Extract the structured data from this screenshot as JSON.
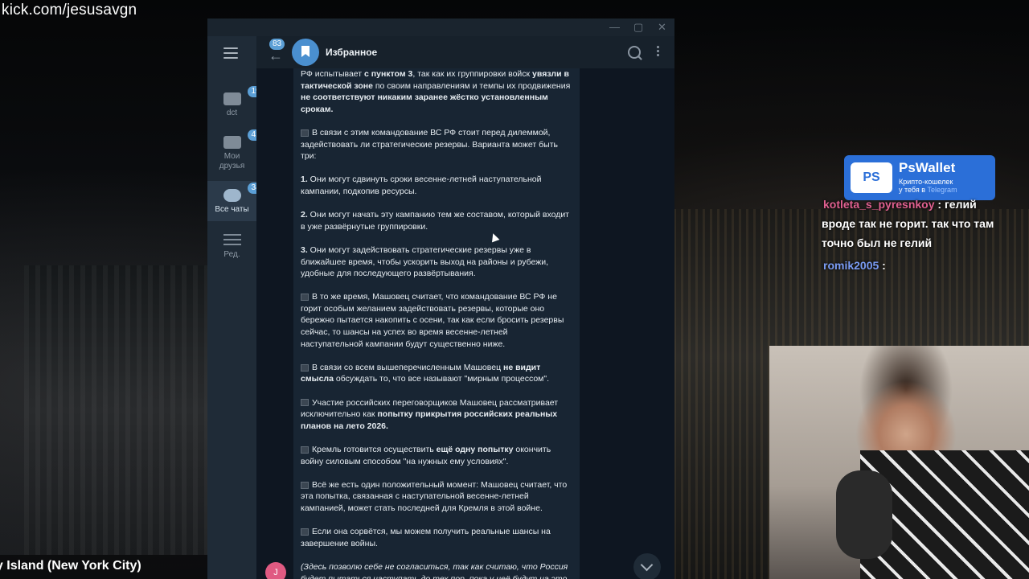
{
  "overlay": {
    "url": "kick.com/jesusavgn",
    "location": "ey Island (New York City)"
  },
  "window": {
    "controls": [
      "—",
      "▢",
      "✕"
    ]
  },
  "rail": {
    "folders": [
      {
        "label": "dct",
        "badge": "191"
      },
      {
        "label": "Мои друзья",
        "badge": "41"
      },
      {
        "label": "Все чаты",
        "badge": "349"
      },
      {
        "label": "Ред.",
        "badge": ""
      }
    ]
  },
  "header": {
    "back_badge": "83",
    "title": "Избранное"
  },
  "message": {
    "p1_a": "РФ испытывает ",
    "p1_b": "с пунктом 3",
    "p1_c": ", так как их группировки войск ",
    "p1_d": "увязли в тактической зоне",
    "p1_e": " по своим направлениям и темпы их продвижения ",
    "p1_f": "не соответствуют никаким заранее жёстко установленным срокам.",
    "p2": "В связи с этим командование ВС РФ стоит перед дилеммой, задействовать ли стратегические резервы. Варианта может быть три:",
    "p3_n": "1.",
    "p3": " Они могут сдвинуть сроки весенне-летней наступательной кампании, подкопив ресурсы.",
    "p4_n": "2.",
    "p4": " Они могут начать эту кампанию тем же составом, который входит в уже развёрнутые группировки.",
    "p5_n": "3.",
    "p5": " Они могут задействовать стратегические резервы уже в ближайшее время, чтобы ускорить выход на районы и рубежи, удобные для последующего развёртывания.",
    "p6": "В то же время, Машовец считает, что командование ВС РФ не горит особым желанием задействовать резервы, которые оно бережно пытается накопить с осени, так как если бросить резервы сейчас, то шансы на успех во время весенне-летней наступательной кампании будут существенно ниже.",
    "p7_a": "В связи со всем вышеперечисленным Машовец ",
    "p7_b": "не видит смысла",
    "p7_c": " обсуждать то, что все называют \"мирным процессом\".",
    "p8_a": "Участие российских переговорщиков Машовец рассматривает исключительно как ",
    "p8_b": "попытку прикрытия российских реальных планов на лето 2026.",
    "p9_a": "Кремль готовится осуществить ",
    "p9_b": "ещё одну попытку",
    "p9_c": " окончить войну силовым способом \"на нужных ему условиях\".",
    "p10": "Всё же есть один положительный момент: Машовец считает, что эта попытка, связанная с наступательной весенне-летней кампанией, может стать последней для Кремля в этой войне.",
    "p11": "Если она сорвётся, мы можем получить реальные шансы на завершение войны.",
    "p12": "(Здесь позволю себе не согласиться, так как считаю, что Россия будет пытаться наступать до тех пор, пока у неё будут на это"
  },
  "avatar_letter": "J",
  "wallet": {
    "logo": "PS",
    "name": "PsWallet",
    "sub1": "Крипто-кошелек",
    "sub2": "у тебя в ",
    "sub_tg": "Telegram"
  },
  "chat_overlay": {
    "user1": "kotleta_s_pyresnkoy",
    "msg1a": " : гелий",
    "msg1b": "вроде так не горит. так что там",
    "msg1c": "точно был не гелий",
    "user2": "romik2005",
    "msg2": " :"
  }
}
